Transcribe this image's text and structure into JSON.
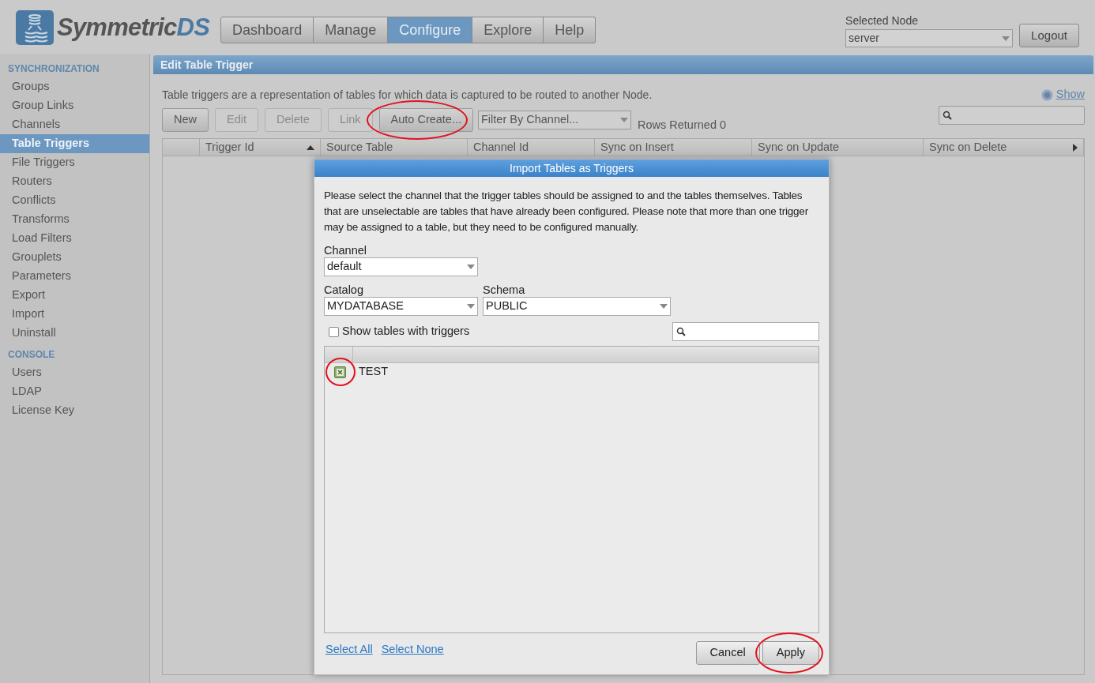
{
  "header": {
    "logo_text": "Symmetric",
    "logo_accent": "DS",
    "nav": [
      {
        "label": "Dashboard",
        "selected": false
      },
      {
        "label": "Manage",
        "selected": false
      },
      {
        "label": "Configure",
        "selected": true
      },
      {
        "label": "Explore",
        "selected": false
      },
      {
        "label": "Help",
        "selected": false
      }
    ],
    "node_label": "Selected Node",
    "node_value": "server",
    "logout": "Logout"
  },
  "sidebar": [
    {
      "title": "SYNCHRONIZATION",
      "items": [
        {
          "label": "Groups",
          "selected": false
        },
        {
          "label": "Group Links",
          "selected": false
        },
        {
          "label": "Channels",
          "selected": false
        },
        {
          "label": "Table Triggers",
          "selected": true
        },
        {
          "label": "File Triggers",
          "selected": false
        },
        {
          "label": "Routers",
          "selected": false
        },
        {
          "label": "Conflicts",
          "selected": false
        },
        {
          "label": "Transforms",
          "selected": false
        },
        {
          "label": "Load Filters",
          "selected": false
        },
        {
          "label": "Grouplets",
          "selected": false
        },
        {
          "label": "Parameters",
          "selected": false
        },
        {
          "label": "Export",
          "selected": false
        },
        {
          "label": "Import",
          "selected": false
        },
        {
          "label": "Uninstall",
          "selected": false
        }
      ]
    },
    {
      "title": "CONSOLE",
      "items": [
        {
          "label": "Users",
          "selected": false
        },
        {
          "label": "LDAP",
          "selected": false
        },
        {
          "label": "License Key",
          "selected": false
        }
      ]
    }
  ],
  "page": {
    "title": "Edit Table Trigger",
    "description": "Table triggers are a representation of tables for which data is captured to be routed to another Node.",
    "help_link": "Show",
    "toolbar": [
      {
        "label": "New",
        "disabled": false,
        "annotated": false
      },
      {
        "label": "Edit",
        "disabled": true,
        "annotated": false
      },
      {
        "label": "Delete",
        "disabled": true,
        "annotated": false
      },
      {
        "label": "Link",
        "disabled": true,
        "annotated": false
      },
      {
        "label": "Auto Create...",
        "disabled": false,
        "annotated": true
      }
    ],
    "filter_placeholder": "Filter By Channel...",
    "rows_returned": "Rows Returned 0",
    "columns": [
      {
        "label": "Trigger Id",
        "sorted": true
      },
      {
        "label": "Source Table",
        "sorted": false
      },
      {
        "label": "Channel Id",
        "sorted": false
      },
      {
        "label": "Sync on Insert",
        "sorted": false
      },
      {
        "label": "Sync on Update",
        "sorted": false
      },
      {
        "label": "Sync on Delete",
        "sorted": false
      }
    ]
  },
  "dialog": {
    "title": "Import Tables as Triggers",
    "message": "Please select the channel that the trigger tables should be assigned to and the tables themselves. Tables that are unselectable are tables that have already been configured. Please note that more than one trigger may be assigned to a table, but they need to be configured manually.",
    "channel_label": "Channel",
    "channel_value": "default",
    "catalog_label": "Catalog",
    "catalog_value": "MYDATABASE",
    "schema_label": "Schema",
    "schema_value": "PUBLIC",
    "show_with_triggers": {
      "label": "Show tables with triggers",
      "checked": false
    },
    "tables": [
      {
        "name": "TEST",
        "checked": true,
        "annotated": true
      }
    ],
    "links": [
      "Select All",
      "Select None"
    ],
    "buttons": [
      {
        "label": "Cancel",
        "annotated": false
      },
      {
        "label": "Apply",
        "annotated": true
      }
    ]
  }
}
